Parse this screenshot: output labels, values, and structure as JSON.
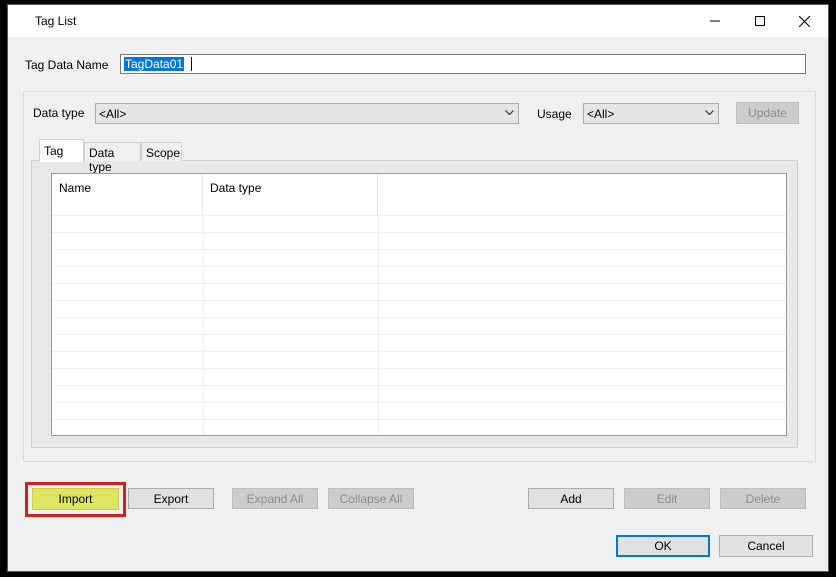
{
  "window": {
    "title": "Tag List"
  },
  "caption_buttons": [
    "minimize-icon",
    "maximize-icon",
    "close-icon"
  ],
  "fields": {
    "tag_data_name_label": "Tag Data Name",
    "tag_data_name_value": "TagData01"
  },
  "filters": {
    "data_type_label": "Data type",
    "data_type_value": "<All>",
    "usage_label": "Usage",
    "usage_value": "<All>",
    "update_label": "Update"
  },
  "tabs": [
    {
      "label": "Tag",
      "active": true
    },
    {
      "label": "Data type",
      "active": false
    },
    {
      "label": "Scope",
      "active": false
    }
  ],
  "grid": {
    "columns": [
      "Name",
      "Data type",
      ""
    ],
    "rows": []
  },
  "actions": {
    "import": "Import",
    "export": "Export",
    "expand_all": "Expand All",
    "collapse_all": "Collapse All",
    "add": "Add",
    "edit": "Edit",
    "delete": "Delete"
  },
  "footer": {
    "ok": "OK",
    "cancel": "Cancel"
  },
  "colors": {
    "selection": "#0078d7",
    "highlight_button": "#dfe462",
    "highlight_frame": "#d21f1f"
  }
}
